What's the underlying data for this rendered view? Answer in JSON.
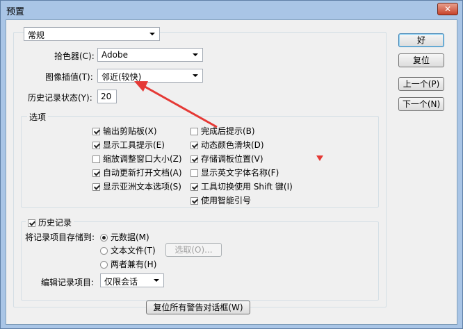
{
  "window": {
    "title": "预置",
    "close_glyph": "✕"
  },
  "section_combo": {
    "value": "常规"
  },
  "color_picker": {
    "label": "拾色器(C):",
    "value": "Adobe"
  },
  "interpolation": {
    "label": "图像插值(T):",
    "value": "邻近(较快)"
  },
  "history_states": {
    "label": "历史记录状态(Y):",
    "value": "20"
  },
  "options": {
    "legend": "选项",
    "left": [
      {
        "label": "输出剪贴板(X)",
        "checked": true
      },
      {
        "label": "显示工具提示(E)",
        "checked": true
      },
      {
        "label": "缩放调整窗口大小(Z)",
        "checked": false
      },
      {
        "label": "自动更新打开文档(A)",
        "checked": true
      },
      {
        "label": "显示亚洲文本选项(S)",
        "checked": true
      }
    ],
    "right": [
      {
        "label": "完成后提示(B)",
        "checked": false
      },
      {
        "label": "动态颜色滑块(D)",
        "checked": true
      },
      {
        "label": "存储调板位置(V)",
        "checked": true
      },
      {
        "label": "显示英文字体名称(F)",
        "checked": false
      },
      {
        "label": "工具切换使用 Shift 键(I)",
        "checked": true
      },
      {
        "label": "使用智能引号",
        "checked": true
      }
    ]
  },
  "history_log": {
    "legend": "历史记录",
    "checked": true,
    "save_to_label": "将记录项目存储到:",
    "radios": [
      {
        "label": "元数据(M)",
        "selected": true
      },
      {
        "label": "文本文件(T)",
        "selected": false
      },
      {
        "label": "两者兼有(H)",
        "selected": false
      }
    ],
    "choose_button": "选取(O)...",
    "edit_log_label": "编辑记录项目:",
    "edit_log_value": "仅限会话"
  },
  "reset_warnings_button": "复位所有警告对话框(W)",
  "side_buttons": {
    "ok": "好",
    "reset": "复位",
    "prev": "上一个(P)",
    "next": "下一个(N)"
  },
  "colors": {
    "arrow": "#e53935",
    "title_bg": "#a9c5e6"
  }
}
